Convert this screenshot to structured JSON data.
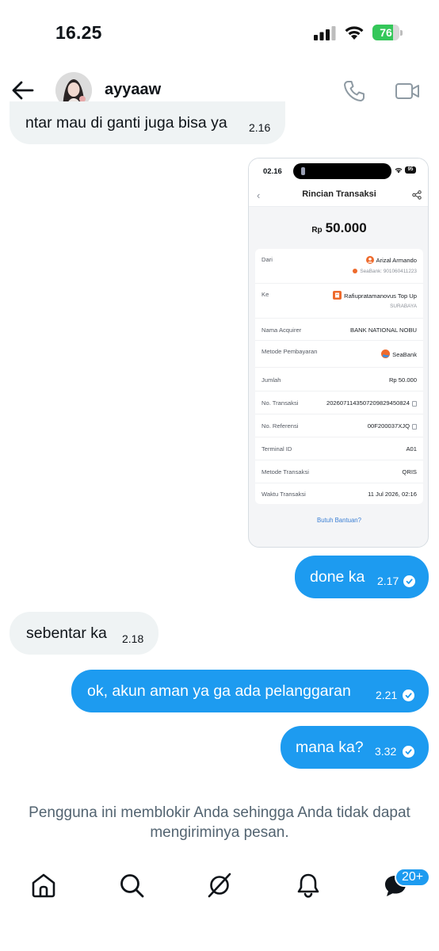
{
  "status_bar": {
    "time": "16.25",
    "battery": "76",
    "battery_level": 0.76
  },
  "header": {
    "username": "ayyaaw"
  },
  "messages": [
    {
      "side": "in",
      "text": "ntar mau di ganti juga bisa ya",
      "time": "2.16"
    },
    {
      "side": "out",
      "text": "done ka",
      "time": "2.17",
      "read": true
    },
    {
      "side": "in",
      "text": "sebentar ka",
      "time": "2.18"
    },
    {
      "side": "out",
      "text": "ok, akun aman ya ga ada pelanggaran",
      "time": "2.21",
      "read": true
    },
    {
      "side": "out",
      "text": "mana ka?",
      "time": "3.32",
      "read": true
    }
  ],
  "receipt": {
    "status_time": "02.16",
    "battery": "95",
    "title": "Rincian Transaksi",
    "currency": "Rp",
    "amount": "50.000",
    "from_label": "Dari",
    "from_name": "Arizal Armando",
    "from_account": "SeaBank: 901060411223",
    "to_label": "Ke",
    "to_name": "Rafiupratamanovus Top Up",
    "to_city": "SURABAYA",
    "acquirer_label": "Nama Acquirer",
    "acquirer_value": "BANK NATIONAL NOBU",
    "payment_method_label": "Metode Pembayaran",
    "payment_method_value": "SeaBank",
    "total_label": "Jumlah",
    "total_value": "Rp 50.000",
    "trx_no_label": "No. Transaksi",
    "trx_no_value": "20260711435072098294508​24",
    "ref_no_label": "No. Referensi",
    "ref_no_value": "00F200037XJQ",
    "terminal_label": "Terminal ID",
    "terminal_value": "A01",
    "trx_method_label": "Metode Transaksi",
    "trx_method_value": "QRIS",
    "trx_time_label": "Waktu Transaksi",
    "trx_time_value": "11 Jul 2026, 02:16",
    "help_link": "Butuh Bantuan?"
  },
  "blocked_notice": "Pengguna ini memblokir Anda sehingga Anda tidak dapat mengiriminya pesan.",
  "bottom_nav": {
    "messages_badge": "20+"
  },
  "colors": {
    "accent": "#1d9bf0",
    "incoming_bubble": "#eff3f4",
    "muted_text": "#536471",
    "battery_green": "#34c759"
  }
}
